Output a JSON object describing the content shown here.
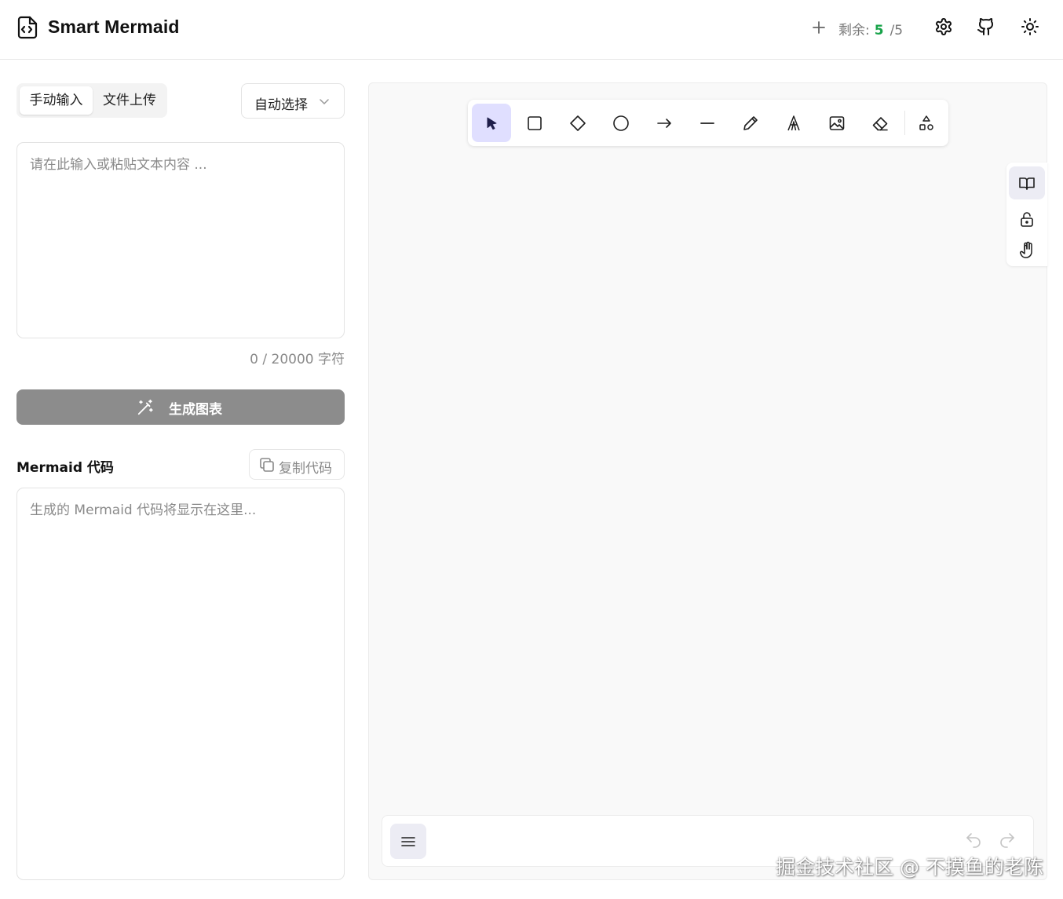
{
  "header": {
    "title": "Smart Mermaid",
    "remain_label": "剩余:",
    "remain_count": "5",
    "remain_total": "/5",
    "icons": [
      "file-code-icon",
      "plus-icon",
      "gear-icon",
      "github-icon",
      "sun-icon"
    ]
  },
  "input": {
    "tabs": [
      {
        "label": "手动输入",
        "active": true
      },
      {
        "label": "文件上传",
        "active": false
      }
    ],
    "select_value": "自动选择",
    "placeholder": "请在此输入或粘贴文本内容 ...",
    "counter": "0 / 20000 字符"
  },
  "generate": {
    "label": "生成图表"
  },
  "code": {
    "title": "Mermaid 代码",
    "copy_label": "复制代码",
    "placeholder": "生成的 Mermaid 代码将显示在这里..."
  },
  "canvas": {
    "tools": [
      "select",
      "rectangle",
      "diamond",
      "ellipse",
      "arrow",
      "line",
      "draw",
      "text",
      "image",
      "eraser",
      "more-shapes"
    ],
    "active_tool": "select",
    "side_tools": [
      "library",
      "lock",
      "hand"
    ],
    "accent_color": "#e0dfff"
  },
  "watermark": "掘金技术社区 @ 不摸鱼的老陈"
}
